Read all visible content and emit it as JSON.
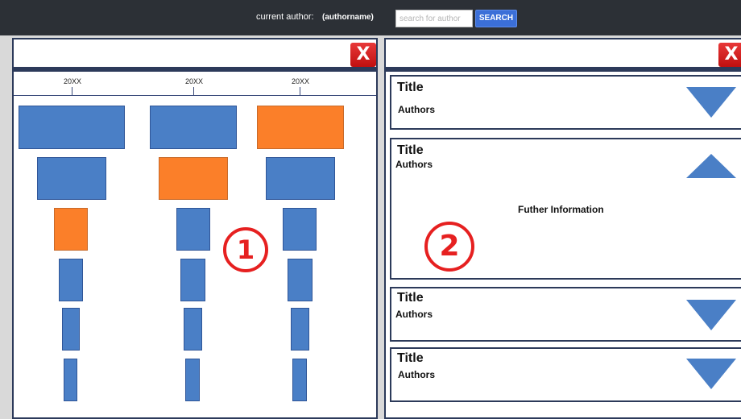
{
  "topbar": {
    "current_author_label": "current author:",
    "current_author_value": "(authorname)",
    "search_placeholder": "search for author",
    "search_button": "SEARCH"
  },
  "left_panel": {
    "close_label": "X",
    "tick_labels": [
      "20XX",
      "20XX",
      "20XX"
    ],
    "marker": "1"
  },
  "right_panel": {
    "close_label": "X",
    "marker": "2",
    "cards": [
      {
        "title": "Title",
        "authors": "Authors",
        "expanded": false
      },
      {
        "title": "Title",
        "authors": "Authors",
        "expanded": true,
        "details": "Futher Information"
      },
      {
        "title": "Title",
        "authors": "Authors",
        "expanded": false
      },
      {
        "title": "Title",
        "authors": "Authors",
        "expanded": false
      }
    ]
  },
  "colors": {
    "blue_box": "#4a7fc6",
    "orange_box": "#fb7f29",
    "marker_red": "#e62020",
    "topbar": "#2c3036"
  }
}
